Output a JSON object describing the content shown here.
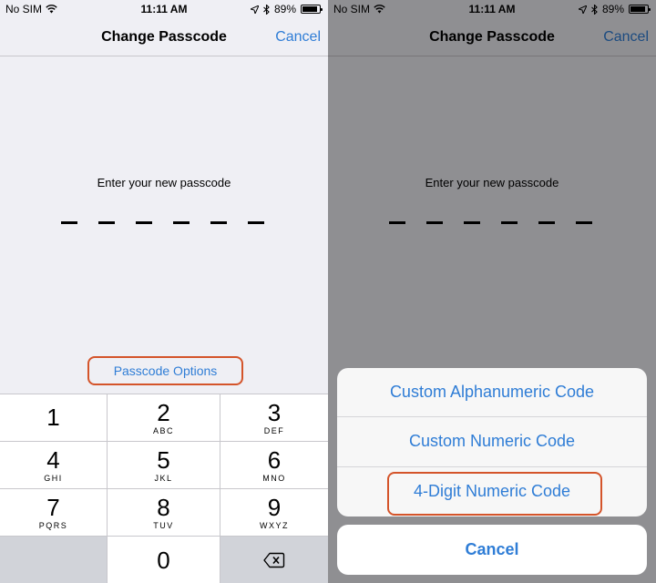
{
  "statusbar": {
    "carrier": "No SIM",
    "time": "11:11 AM",
    "battery": "89%",
    "battery_level": 0.89,
    "icons": [
      "wifi-icon",
      "location-arrow-icon",
      "bluetooth-icon",
      "battery-icon"
    ]
  },
  "navbar": {
    "title": "Change Passcode",
    "cancel_label": "Cancel"
  },
  "passcode": {
    "prompt": "Enter your new passcode",
    "digit_count": 6
  },
  "options_button": {
    "label": "Passcode Options"
  },
  "keypad": {
    "keys": [
      {
        "num": "1",
        "letters": ""
      },
      {
        "num": "2",
        "letters": "ABC"
      },
      {
        "num": "3",
        "letters": "DEF"
      },
      {
        "num": "4",
        "letters": "GHI"
      },
      {
        "num": "5",
        "letters": "JKL"
      },
      {
        "num": "6",
        "letters": "MNO"
      },
      {
        "num": "7",
        "letters": "PQRS"
      },
      {
        "num": "8",
        "letters": "TUV"
      },
      {
        "num": "9",
        "letters": "WXYZ"
      },
      {
        "num": "0",
        "letters": ""
      }
    ],
    "delete_icon": "delete-backspace-icon"
  },
  "action_sheet": {
    "items": [
      {
        "label": "Custom Alphanumeric Code"
      },
      {
        "label": "Custom Numeric Code"
      },
      {
        "label": "4-Digit Numeric Code",
        "highlighted": true
      }
    ],
    "cancel_label": "Cancel"
  },
  "colors": {
    "accent": "#2f7dd6",
    "highlight_border": "#d4542a",
    "background": "#efeff4"
  }
}
